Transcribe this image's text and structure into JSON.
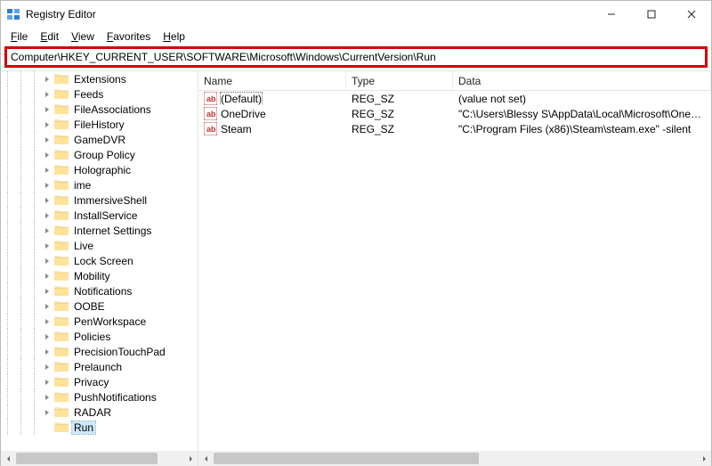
{
  "window": {
    "title": "Registry Editor"
  },
  "menu": {
    "file": "File",
    "edit": "Edit",
    "view": "View",
    "favorites": "Favorites",
    "help": "Help"
  },
  "address": {
    "path": "Computer\\HKEY_CURRENT_USER\\SOFTWARE\\Microsoft\\Windows\\CurrentVersion\\Run"
  },
  "tree": {
    "items": [
      {
        "label": "Extensions",
        "depth": 4,
        "expandable": true,
        "expanded": false,
        "selected": false
      },
      {
        "label": "Feeds",
        "depth": 4,
        "expandable": true,
        "expanded": false,
        "selected": false
      },
      {
        "label": "FileAssociations",
        "depth": 4,
        "expandable": true,
        "expanded": false,
        "selected": false
      },
      {
        "label": "FileHistory",
        "depth": 4,
        "expandable": true,
        "expanded": false,
        "selected": false
      },
      {
        "label": "GameDVR",
        "depth": 4,
        "expandable": true,
        "expanded": false,
        "selected": false
      },
      {
        "label": "Group Policy",
        "depth": 4,
        "expandable": true,
        "expanded": false,
        "selected": false
      },
      {
        "label": "Holographic",
        "depth": 4,
        "expandable": true,
        "expanded": false,
        "selected": false
      },
      {
        "label": "ime",
        "depth": 4,
        "expandable": true,
        "expanded": false,
        "selected": false
      },
      {
        "label": "ImmersiveShell",
        "depth": 4,
        "expandable": true,
        "expanded": false,
        "selected": false
      },
      {
        "label": "InstallService",
        "depth": 4,
        "expandable": true,
        "expanded": false,
        "selected": false
      },
      {
        "label": "Internet Settings",
        "depth": 4,
        "expandable": true,
        "expanded": false,
        "selected": false
      },
      {
        "label": "Live",
        "depth": 4,
        "expandable": true,
        "expanded": false,
        "selected": false
      },
      {
        "label": "Lock Screen",
        "depth": 4,
        "expandable": true,
        "expanded": false,
        "selected": false
      },
      {
        "label": "Mobility",
        "depth": 4,
        "expandable": true,
        "expanded": false,
        "selected": false
      },
      {
        "label": "Notifications",
        "depth": 4,
        "expandable": true,
        "expanded": false,
        "selected": false
      },
      {
        "label": "OOBE",
        "depth": 4,
        "expandable": true,
        "expanded": false,
        "selected": false
      },
      {
        "label": "PenWorkspace",
        "depth": 4,
        "expandable": true,
        "expanded": false,
        "selected": false
      },
      {
        "label": "Policies",
        "depth": 4,
        "expandable": true,
        "expanded": false,
        "selected": false
      },
      {
        "label": "PrecisionTouchPad",
        "depth": 4,
        "expandable": true,
        "expanded": false,
        "selected": false
      },
      {
        "label": "Prelaunch",
        "depth": 4,
        "expandable": true,
        "expanded": false,
        "selected": false
      },
      {
        "label": "Privacy",
        "depth": 4,
        "expandable": true,
        "expanded": false,
        "selected": false
      },
      {
        "label": "PushNotifications",
        "depth": 4,
        "expandable": true,
        "expanded": false,
        "selected": false
      },
      {
        "label": "RADAR",
        "depth": 4,
        "expandable": true,
        "expanded": false,
        "selected": false
      },
      {
        "label": "Run",
        "depth": 4,
        "expandable": false,
        "expanded": false,
        "selected": true
      }
    ]
  },
  "list": {
    "columns": {
      "name": "Name",
      "type": "Type",
      "data": "Data"
    },
    "rows": [
      {
        "name": "(Default)",
        "type": "REG_SZ",
        "data": "(value not set)",
        "focused": true
      },
      {
        "name": "OneDrive",
        "type": "REG_SZ",
        "data": "\"C:\\Users\\Blessy S\\AppData\\Local\\Microsoft\\OneD...",
        "focused": false
      },
      {
        "name": "Steam",
        "type": "REG_SZ",
        "data": "\"C:\\Program Files (x86)\\Steam\\steam.exe\" -silent",
        "focused": false
      }
    ]
  }
}
